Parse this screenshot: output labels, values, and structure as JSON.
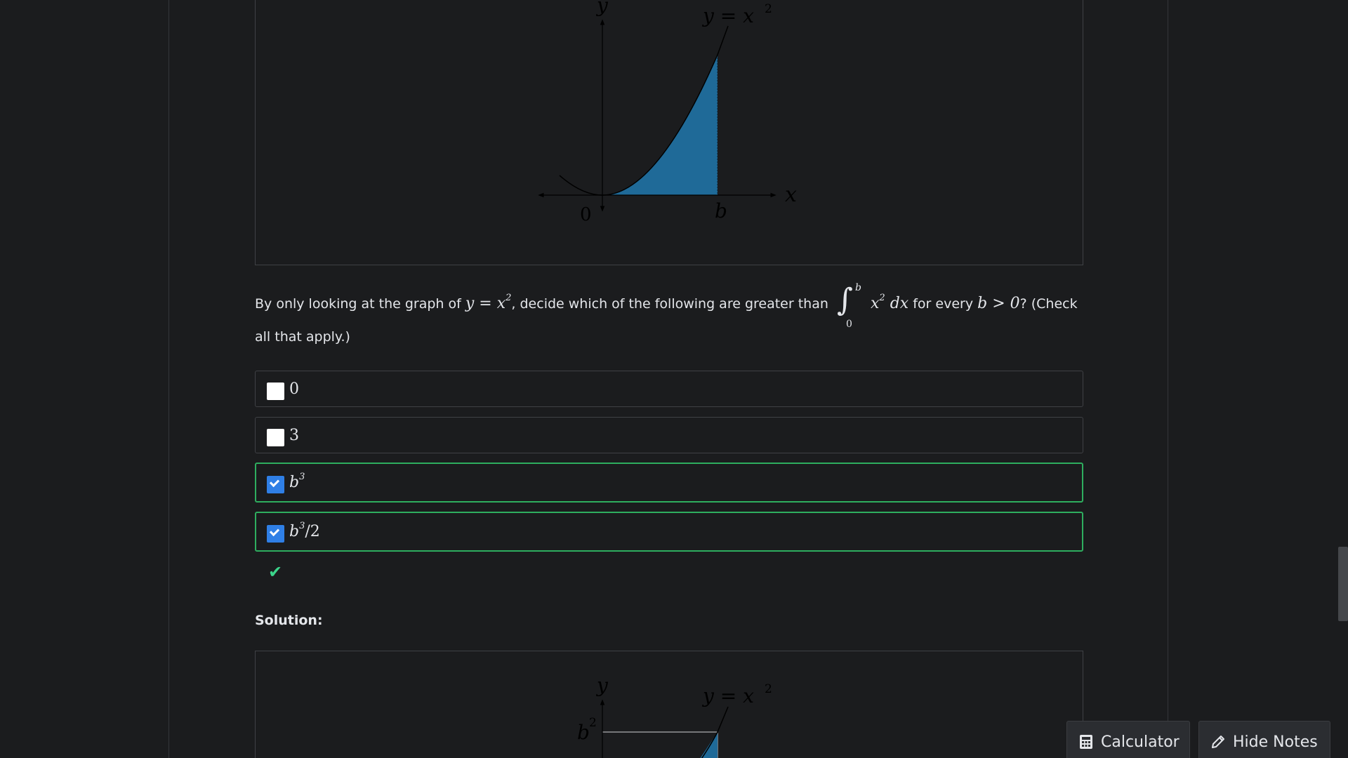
{
  "figure_top": {
    "y_axis_label": "y",
    "x_axis_label": "x",
    "curve_label": "y = x",
    "curve_label_exp": "2",
    "origin_label": "0",
    "b_label": "b"
  },
  "question": {
    "text_1": "By only looking at the graph of",
    "math_1": "y = x",
    "math_1_exp": "2",
    "text_2": ", decide which of the following are greater than",
    "integral_sign": "∫",
    "integral_upper": "b",
    "integral_lower": "0",
    "integrand": "x",
    "integrand_exp": "2",
    "integrand_dx": " dx",
    "text_3": "for every",
    "condition": "b > 0",
    "text_4": "? (Check all that apply.)"
  },
  "options": [
    {
      "base": "0",
      "exp": "",
      "suffix": "",
      "checked": false
    },
    {
      "base": "3",
      "exp": "",
      "suffix": "",
      "checked": false
    },
    {
      "base": "b",
      "exp": "3",
      "suffix": "",
      "checked": true
    },
    {
      "base": "b",
      "exp": "3",
      "suffix": "/2",
      "checked": true
    }
  ],
  "result": {
    "icon": "checkmark-icon",
    "glyph": "✔",
    "color": "#3bd48a"
  },
  "solution": {
    "label": "Solution:",
    "figure": {
      "y_axis_label": "y",
      "curve_label": "y = x",
      "curve_label_exp": "2",
      "b2_label": "b",
      "b2_exp": "2"
    }
  },
  "toolbar": {
    "calculator_label": "Calculator",
    "calculator_icon": "calculator-icon",
    "notes_label": "Hide Notes",
    "notes_icon": "pencil-icon"
  },
  "colors": {
    "background": "#1b1c1e",
    "shaded_area": "#1f6a98",
    "selected_border": "#2eae5f",
    "checkbox_checked": "#2f7fe6"
  }
}
